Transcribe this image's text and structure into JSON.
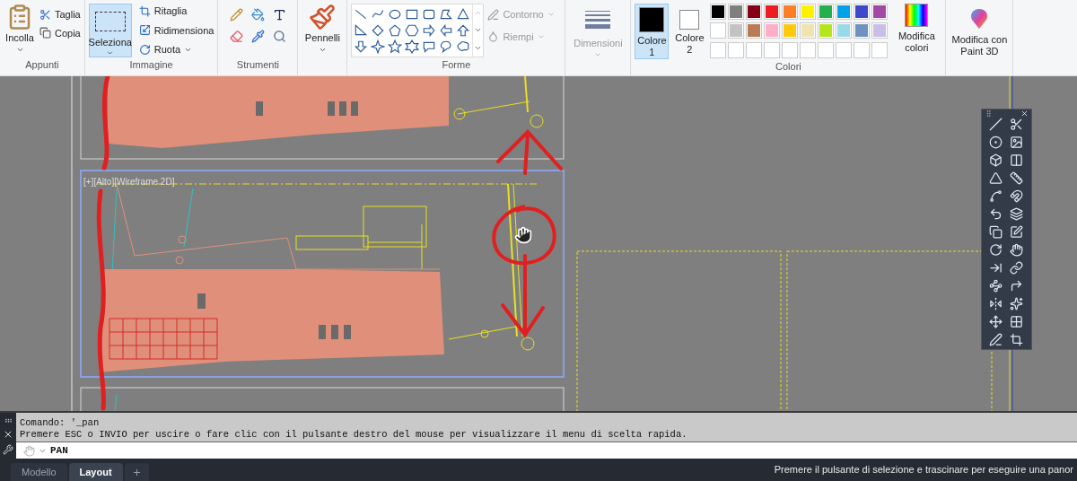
{
  "ribbon": {
    "clipboard": {
      "label": "Appunti",
      "paste": "Incolla",
      "items": [
        "Taglia",
        "Copia"
      ]
    },
    "image": {
      "label": "Immagine",
      "select": {
        "label": "Seleziona",
        "selected": true
      },
      "items": [
        {
          "label": "Ritaglia",
          "dropdown": false
        },
        {
          "label": "Ridimensiona",
          "dropdown": false
        },
        {
          "label": "Ruota",
          "dropdown": true
        }
      ]
    },
    "tools": {
      "label": "Strumenti"
    },
    "brushes": {
      "label": "Pennelli"
    },
    "shapes": {
      "label": "Forme",
      "outline": {
        "label": "Contorno",
        "disabled": true
      },
      "fill": {
        "label": "Riempi",
        "disabled": true
      }
    },
    "size": {
      "label": "Dimensioni",
      "disabled": true
    },
    "colors": {
      "label": "Colori",
      "slots": [
        {
          "label": "Colore 1",
          "color": "#000000",
          "selected": true
        },
        {
          "label": "Colore 2",
          "color": "#ffffff",
          "selected": false
        }
      ],
      "palette": [
        {
          "color": "#000000"
        },
        {
          "color": "#7f7f7f"
        },
        {
          "color": "#880015"
        },
        {
          "color": "#ed1c24"
        },
        {
          "color": "#ff7f27"
        },
        {
          "color": "#fff200"
        },
        {
          "color": "#22b14c"
        },
        {
          "color": "#00a2e8"
        },
        {
          "color": "#3f48cc"
        },
        {
          "color": "#a349a4"
        },
        {
          "color": "#ffffff"
        },
        {
          "color": "#c3c3c3"
        },
        {
          "color": "#b97a57"
        },
        {
          "color": "#ffaec9"
        },
        {
          "color": "#ffc90e"
        },
        {
          "color": "#efe4b0"
        },
        {
          "color": "#b5e61d"
        },
        {
          "color": "#99d9ea"
        },
        {
          "color": "#7092be"
        },
        {
          "color": "#c8bfe7"
        }
      ],
      "edit": "Modifica colori"
    },
    "paint3d": "Modifica con Paint 3D"
  },
  "viewport": {
    "label": "[+][Alto][Wireframe 2D]"
  },
  "command_line": {
    "history": [
      "Comando: '_pan",
      "Premere ESC o INVIO per uscire o fare clic con il pulsante destro del mouse per visualizzare il menu di scelta rapida."
    ],
    "prompt": "PAN"
  },
  "layout_tabs": [
    {
      "label": "Modello",
      "selected": false
    },
    {
      "label": "Layout",
      "selected": true
    }
  ],
  "status_bar": "Premere il pulsante di selezione e trascinare per eseguire una panor"
}
